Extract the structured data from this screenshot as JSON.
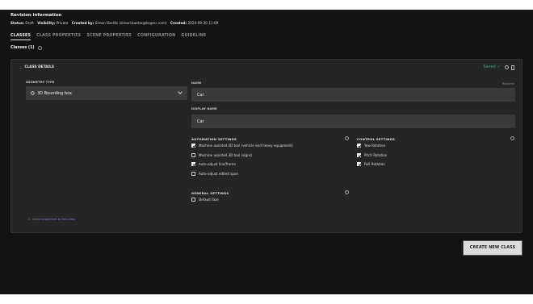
{
  "header": {
    "title": "Revision information",
    "status_label": "Status:",
    "status_value": "Draft",
    "visibility_label": "Visibility:",
    "visibility_value": "Private",
    "created_by_label": "Created by:",
    "created_by_value": "Simon Bastås (simon.bastas@kognic.com)",
    "created_label": "Created:",
    "created_value": "2024-09-30 11:09"
  },
  "tabs": [
    {
      "label": "CLASSES",
      "active": true
    },
    {
      "label": "CLASS PROPERTIES",
      "active": false
    },
    {
      "label": "SCENE PROPERTIES",
      "active": false
    },
    {
      "label": "CONFIGURATION",
      "active": false
    },
    {
      "label": "GUIDELINE",
      "active": false
    }
  ],
  "classes_heading": "Classes (1)",
  "class_details": {
    "title": "CLASS DETAILS",
    "saved_text": "Saved",
    "geometry_type_label": "GEOMETRY TYPE",
    "geometry_type_value": "3D Bounding box",
    "required_text": "Required",
    "name_label": "NAME",
    "name_value": "Car",
    "display_name_label": "DISPLAY NAME",
    "display_name_value": "Car",
    "automation_settings": {
      "title": "AUTOMATION SETTINGS",
      "options": [
        {
          "label": "Machine assisted 3D tool (vehicle and heavy equipment)",
          "checked": true
        },
        {
          "label": "Machine assisted 3D tool (signs)",
          "checked": false
        },
        {
          "label": "Auto-adjust line/frame",
          "checked": true
        },
        {
          "label": "Auto-adjust edited span",
          "checked": false
        }
      ]
    },
    "control_settings": {
      "title": "CONTROL SETTINGS",
      "options": [
        {
          "label": "Yaw Rotation",
          "checked": true
        },
        {
          "label": "Pitch Rotation",
          "checked": true
        },
        {
          "label": "Roll Rotation",
          "checked": true
        }
      ]
    },
    "general_settings": {
      "title": "GENERAL SETTINGS",
      "options": [
        {
          "label": "Default Size",
          "checked": false
        }
      ]
    },
    "select_properties_link": "Select properties to this class"
  },
  "create_button_label": "CREATE NEW CLASS",
  "colors": {
    "background": "#131313",
    "panel": "#252525",
    "field": "#3a3a3a",
    "saved_green": "#3fa95a",
    "link_purple": "#8f7fd4"
  }
}
